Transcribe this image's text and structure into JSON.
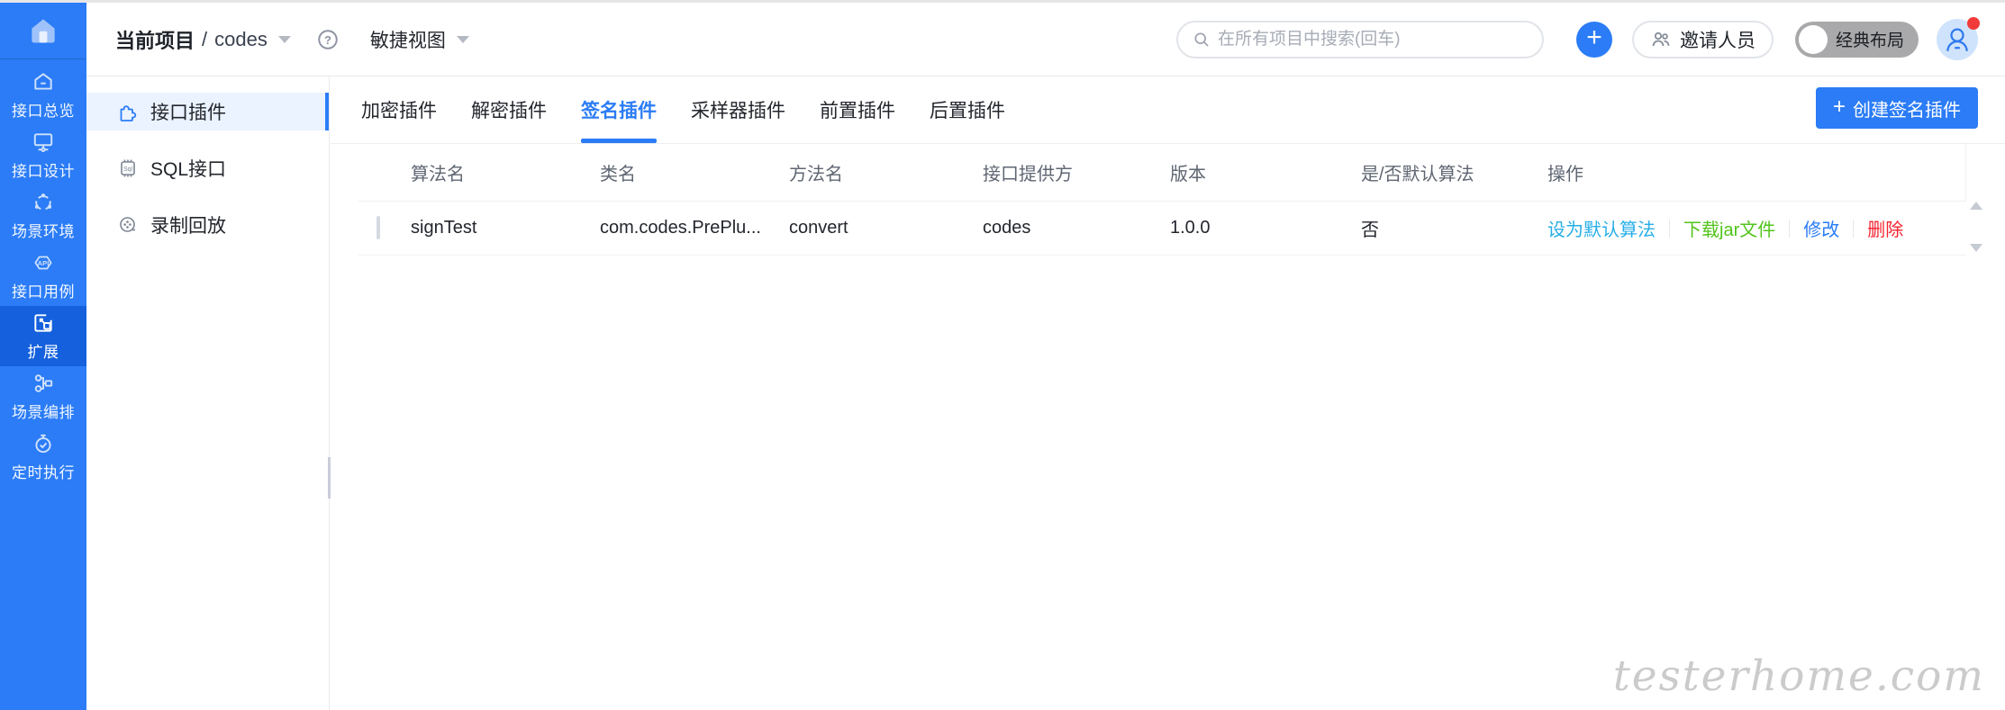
{
  "header": {
    "breadcrumb": {
      "label": "当前项目",
      "separator": "/",
      "project": "codes"
    },
    "view_switcher": "敏捷视图",
    "search": {
      "placeholder": "在所有项目中搜索(回车)"
    },
    "plus_label": "+",
    "invite_label": "邀请人员",
    "layout_toggle_label": "经典布局"
  },
  "sidebar": {
    "items": [
      {
        "label": "接口总览",
        "icon": "home-outline-icon",
        "active": false
      },
      {
        "label": "接口设计",
        "icon": "monitor-icon",
        "active": false
      },
      {
        "label": "场景环境",
        "icon": "share-network-icon",
        "active": false
      },
      {
        "label": "接口用例",
        "icon": "api-hexagon-icon",
        "active": false
      },
      {
        "label": "扩展",
        "icon": "extension-icon",
        "active": true
      },
      {
        "label": "场景编排",
        "icon": "flow-icon",
        "active": false
      },
      {
        "label": "定时执行",
        "icon": "timer-icon",
        "active": false
      }
    ]
  },
  "subsidebar": {
    "items": [
      {
        "label": "接口插件",
        "icon": "puzzle-icon",
        "active": true
      },
      {
        "label": "SQL接口",
        "icon": "sql-chip-icon",
        "active": false
      },
      {
        "label": "录制回放",
        "icon": "record-playback-icon",
        "active": false
      }
    ]
  },
  "tabs": [
    {
      "label": "加密插件",
      "active": false
    },
    {
      "label": "解密插件",
      "active": false
    },
    {
      "label": "签名插件",
      "active": true
    },
    {
      "label": "采样器插件",
      "active": false
    },
    {
      "label": "前置插件",
      "active": false
    },
    {
      "label": "后置插件",
      "active": false
    }
  ],
  "create_button": {
    "plus": "+",
    "label": "创建签名插件"
  },
  "table": {
    "columns": [
      "算法名",
      "类名",
      "方法名",
      "接口提供方",
      "版本",
      "是/否默认算法",
      "操作"
    ],
    "rows": [
      {
        "algorithm_name": "signTest",
        "class_name": "com.codes.PrePlu...",
        "method_name": "convert",
        "provider": "codes",
        "version": "1.0.0",
        "is_default": "否",
        "actions": [
          {
            "label": "设为默认算法",
            "color": "#26aee8"
          },
          {
            "label": "下载jar文件",
            "color": "#52c41a"
          },
          {
            "label": "修改",
            "color": "#2b7cf6"
          },
          {
            "label": "删除",
            "color": "#f5222d"
          }
        ]
      }
    ]
  },
  "watermark": "testerhome.com",
  "colors": {
    "primary": "#2b7cf6",
    "sidebar_bg": "#2b7cf6",
    "sidebar_active_bg": "#1460dd",
    "subsidebar_selected_bg": "#eaf3ff",
    "action_set_default": "#26aee8",
    "action_download": "#52c41a",
    "action_edit": "#2b7cf6",
    "action_delete": "#f5222d",
    "avatar_badge": "#f23a3a"
  }
}
